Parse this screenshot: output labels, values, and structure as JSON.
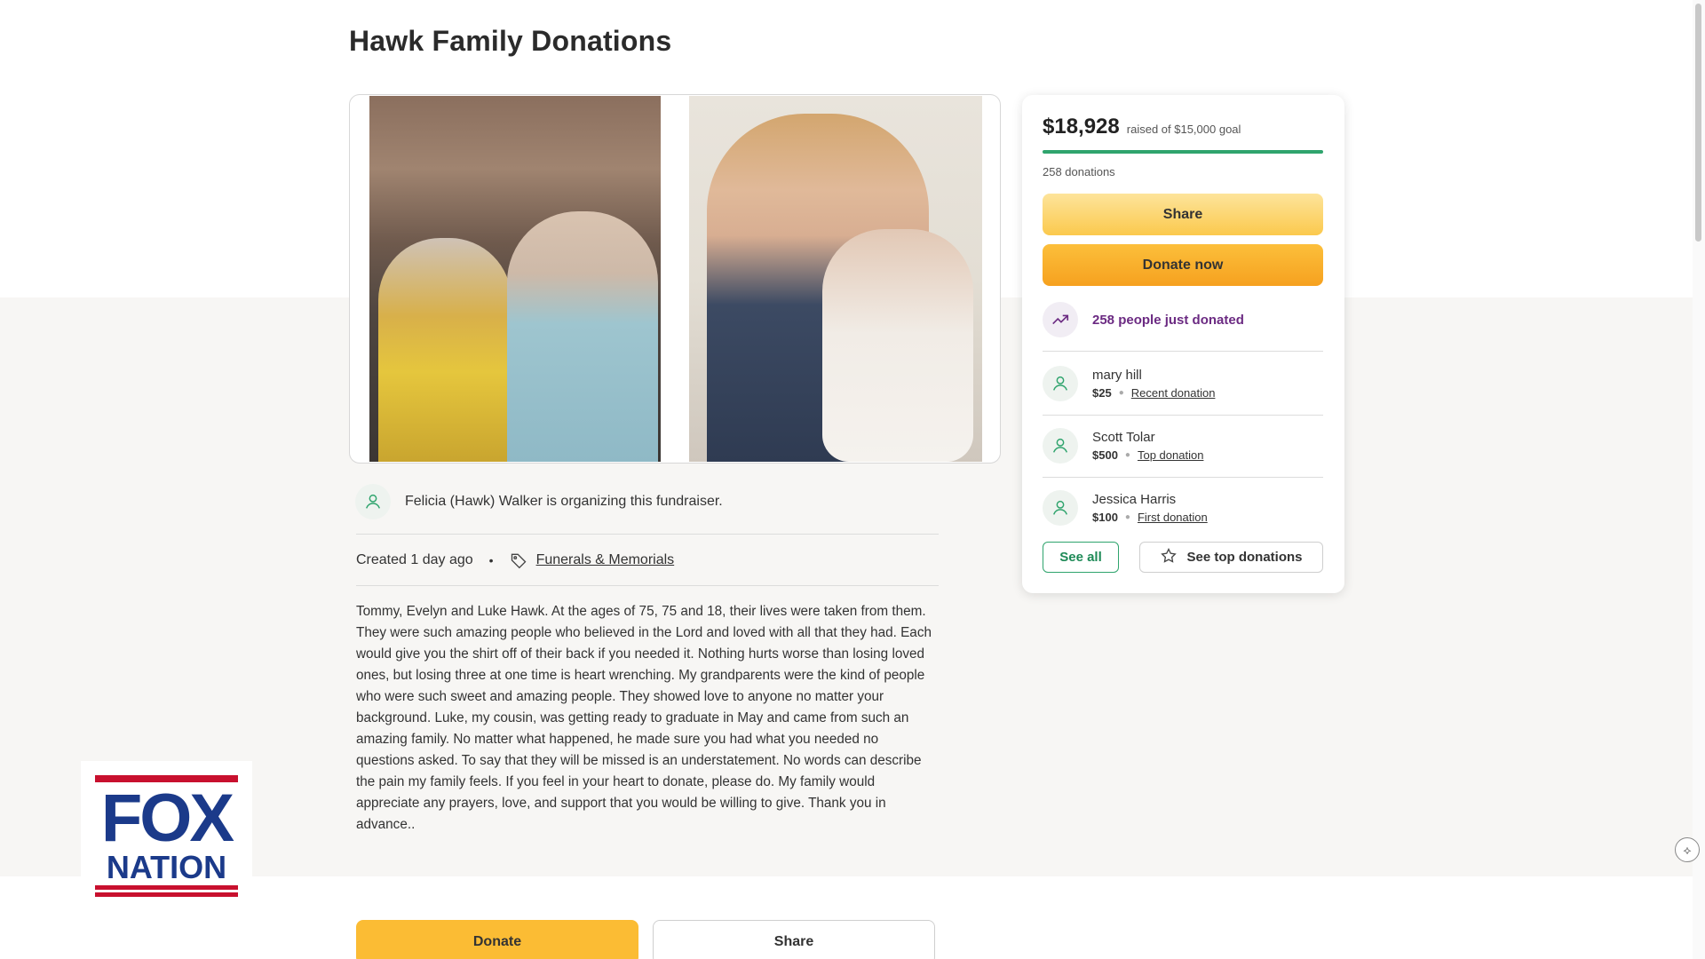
{
  "page": {
    "title": "Hawk Family Donations"
  },
  "organizer": {
    "text": "Felicia (Hawk) Walker is organizing this fundraiser."
  },
  "meta": {
    "created": "Created 1 day ago",
    "separator": "•",
    "category": "Funerals & Memorials"
  },
  "story": "Tommy, Evelyn and Luke Hawk. At the ages of 75, 75 and 18, their lives were taken from them. They were such amazing people who believed in the Lord and loved with all that they had. Each would give you the shirt off of their back if you needed it. Nothing hurts worse than losing loved ones, but losing three at one time is heart wrenching. My grandparents were the kind of people who were such sweet and amazing people. They showed love to anyone no matter your background. Luke, my cousin, was getting ready to graduate in May and came from such an amazing family. No matter what happened, he made sure you had what you needed no questions asked. To say that they will be missed is an understatement. No words can describe the pain my family feels. If you feel in your heart to donate, please do. My family would appreciate any prayers, love, and support that you would be willing to give. Thank you in advance..",
  "bottom_actions": {
    "donate_label": "Donate",
    "share_label": "Share"
  },
  "card": {
    "raised_amount": "$18,928",
    "raised_sub": "raised of $15,000 goal",
    "progress_fraction": 1.0,
    "donation_count": "258 donations",
    "share_label": "Share",
    "donate_label": "Donate now",
    "trending_text": "258 people just donated",
    "donors": [
      {
        "name": "mary hill",
        "amount": "$25",
        "tag": "Recent donation"
      },
      {
        "name": "Scott Tolar",
        "amount": "$500",
        "tag": "Top donation"
      },
      {
        "name": "Jessica Harris",
        "amount": "$100",
        "tag": "First donation"
      }
    ],
    "see_all_label": "See all",
    "see_top_label": "See top donations"
  },
  "watermark": {
    "line1": "FOX",
    "line2": "NATION"
  },
  "colors": {
    "accent_green": "#2fa46d",
    "donate_orange": "#f6a11f",
    "share_yellow": "#fbc94d",
    "trend_purple": "#6b2a82",
    "fox_blue": "#1b3a8a",
    "fox_red": "#c8102e"
  }
}
